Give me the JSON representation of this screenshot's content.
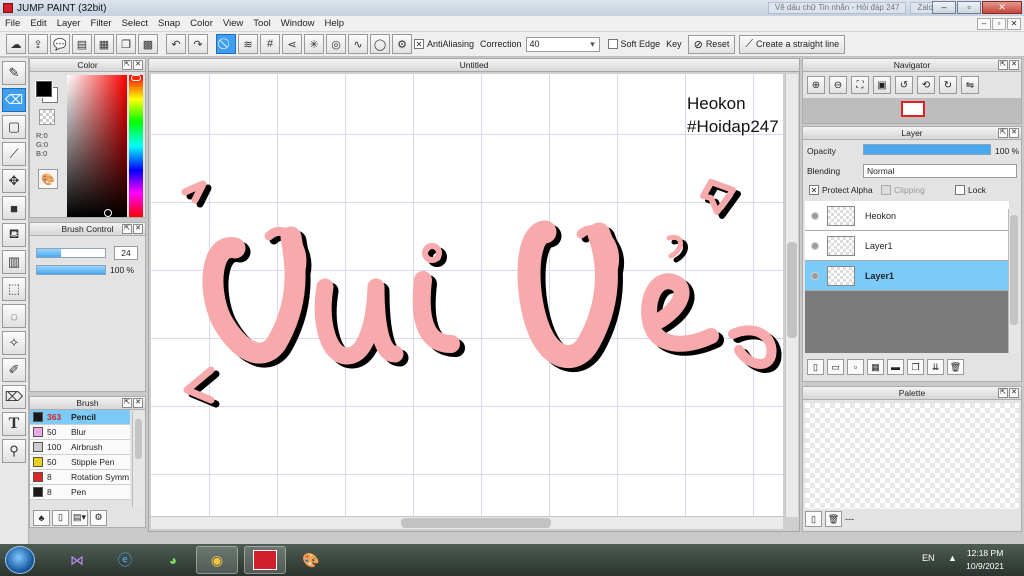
{
  "window": {
    "title": "JUMP PAINT (32bit)",
    "bg_tabs": [
      "",
      "Vẽ dấu chữ Tin nhắn - Hỏi đáp 247",
      "Zalo"
    ],
    "controls": [
      "–",
      "▫",
      "✕"
    ]
  },
  "menu": [
    "File",
    "Edit",
    "Layer",
    "Filter",
    "Select",
    "Snap",
    "Color",
    "View",
    "Tool",
    "Window",
    "Help"
  ],
  "toolbar": {
    "antialiasing_label": "AntiAliasing",
    "antialiasing_checked": true,
    "correction_label": "Correction",
    "correction_value": "40",
    "soft_edge_label": "Soft Edge",
    "key_label": "Key",
    "reset_label": "Reset",
    "straight_line_label": "Create a straight line"
  },
  "color_panel": {
    "title": "Color",
    "r": "R:0",
    "g": "G:0",
    "b": "B:0",
    "foreground": "#000000",
    "background": "#ffffff"
  },
  "brush_control": {
    "title": "Brush Control",
    "size_value": "24",
    "size_fraction": 0.35,
    "opacity_value": "100 %",
    "opacity_fraction": 1.0
  },
  "brush_panel": {
    "title": "Brush",
    "items": [
      {
        "size": "363",
        "name": "Pencil",
        "color": "#1a1a1a",
        "selected": true
      },
      {
        "size": "50",
        "name": "Blur",
        "color": "#f0a8e8",
        "selected": false
      },
      {
        "size": "100",
        "name": "Airbrush",
        "color": "#cccccc",
        "selected": false
      },
      {
        "size": "50",
        "name": "Stipple Pen",
        "color": "#e6d21a",
        "selected": false
      },
      {
        "size": "8",
        "name": "Rotation Symm",
        "color": "#e02424",
        "selected": false
      },
      {
        "size": "8",
        "name": "Pen",
        "color": "#1a1a1a",
        "selected": false
      }
    ]
  },
  "document": {
    "title": "Untitled",
    "watermark_line1": "Heokon",
    "watermark_line2": "#Hoidap247",
    "drawing_color": "#f8a9ac",
    "shadow_color": "#000000"
  },
  "navigator": {
    "title": "Navigator"
  },
  "layer_panel": {
    "title": "Layer",
    "opacity_label": "Opacity",
    "opacity_value": "100 %",
    "opacity_fraction": 1.0,
    "blending_label": "Blending",
    "blending_value": "Normal",
    "protect_alpha_label": "Protect Alpha",
    "protect_alpha_checked": true,
    "clipping_label": "Clipping",
    "lock_label": "Lock",
    "layers": [
      {
        "name": "Heokon",
        "selected": false
      },
      {
        "name": "Layer1",
        "selected": false
      },
      {
        "name": "Layer1",
        "selected": true
      }
    ]
  },
  "palette": {
    "title": "Palette",
    "footer_text": "---"
  },
  "taskbar": {
    "language": "EN",
    "time": "12:18 PM",
    "date": "10/9/2021"
  }
}
